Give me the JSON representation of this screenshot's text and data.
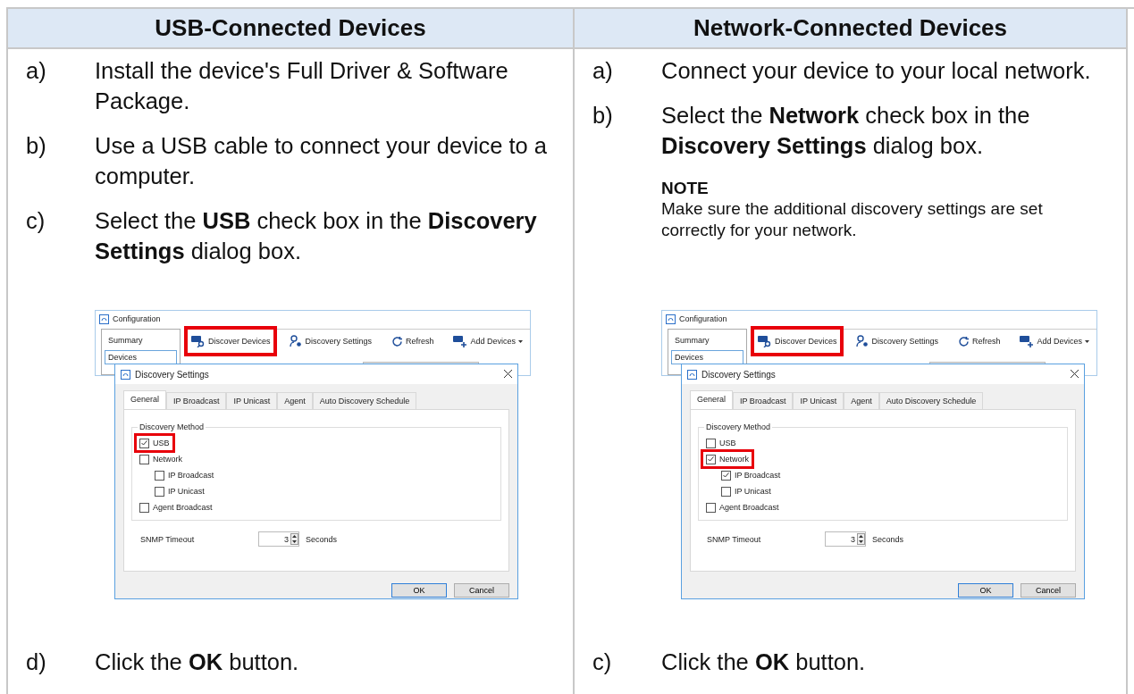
{
  "columns": [
    {
      "heading": "USB-Connected Devices",
      "items": [
        {
          "kind": "step",
          "label": "a)",
          "text": "Install the device's Full Driver & Software Package."
        },
        {
          "kind": "step",
          "label": "b)",
          "text": "Use a USB cable to connect your device to a computer."
        },
        {
          "kind": "step",
          "label": "c)",
          "text": "Select the **USB** check box in the **Discovery Settings** dialog box."
        },
        {
          "kind": "screenshot",
          "window_title": "Configuration",
          "sidebar": [
            {
              "label": "Summary",
              "selected": false
            },
            {
              "label": "Devices",
              "selected": true
            }
          ],
          "toolbar": [
            {
              "label": "Discover Devices",
              "highlighted": true
            },
            {
              "label": "Discovery Settings",
              "highlighted": false
            },
            {
              "label": "Refresh",
              "highlighted": false
            },
            {
              "label": "Add Devices",
              "highlighted": false,
              "dropdown": true
            }
          ],
          "dialog": {
            "title": "Discovery Settings",
            "tabs": [
              {
                "label": "General",
                "selected": true
              },
              {
                "label": "IP Broadcast",
                "selected": false
              },
              {
                "label": "IP Unicast",
                "selected": false
              },
              {
                "label": "Agent",
                "selected": false
              },
              {
                "label": "Auto Discovery Schedule",
                "selected": false
              }
            ],
            "group_label": "Discovery Method",
            "options": [
              {
                "label": "USB",
                "checked": true,
                "highlighted": true
              },
              {
                "label": "Network",
                "checked": false,
                "highlighted": false,
                "children": [
                  {
                    "label": "IP Broadcast",
                    "checked": false,
                    "highlighted": false
                  },
                  {
                    "label": "IP Unicast",
                    "checked": false,
                    "highlighted": false
                  }
                ]
              },
              {
                "label": "Agent Broadcast",
                "checked": false,
                "highlighted": false
              }
            ],
            "timeout_label": "SNMP Timeout",
            "timeout_value": "3",
            "timeout_unit": "Seconds",
            "buttons": [
              {
                "label": "OK",
                "default": true
              },
              {
                "label": "Cancel",
                "default": false
              }
            ]
          }
        },
        {
          "kind": "step",
          "label": "d)",
          "text": "Click the **OK** button."
        }
      ]
    },
    {
      "heading": "Network-Connected Devices",
      "items": [
        {
          "kind": "step",
          "label": "a)",
          "text": "Connect your device to your local network."
        },
        {
          "kind": "step",
          "label": "b)",
          "text": "Select the **Network** check box in the **Discovery Settings** dialog box."
        },
        {
          "kind": "note",
          "title": "NOTE",
          "text": "Make sure the additional discovery settings are set correctly for your network."
        },
        {
          "kind": "screenshot",
          "window_title": "Configuration",
          "sidebar": [
            {
              "label": "Summary",
              "selected": false
            },
            {
              "label": "Devices",
              "selected": true
            }
          ],
          "toolbar": [
            {
              "label": "Discover Devices",
              "highlighted": true
            },
            {
              "label": "Discovery Settings",
              "highlighted": false
            },
            {
              "label": "Refresh",
              "highlighted": false
            },
            {
              "label": "Add Devices",
              "highlighted": false,
              "dropdown": true
            }
          ],
          "dialog": {
            "title": "Discovery Settings",
            "tabs": [
              {
                "label": "General",
                "selected": true
              },
              {
                "label": "IP Broadcast",
                "selected": false
              },
              {
                "label": "IP Unicast",
                "selected": false
              },
              {
                "label": "Agent",
                "selected": false
              },
              {
                "label": "Auto Discovery Schedule",
                "selected": false
              }
            ],
            "group_label": "Discovery Method",
            "options": [
              {
                "label": "USB",
                "checked": false,
                "highlighted": false
              },
              {
                "label": "Network",
                "checked": true,
                "highlighted": true,
                "children": [
                  {
                    "label": "IP Broadcast",
                    "checked": true,
                    "highlighted": false
                  },
                  {
                    "label": "IP Unicast",
                    "checked": false,
                    "highlighted": false
                  }
                ]
              },
              {
                "label": "Agent Broadcast",
                "checked": false,
                "highlighted": false
              }
            ],
            "timeout_label": "SNMP Timeout",
            "timeout_value": "3",
            "timeout_unit": "Seconds",
            "buttons": [
              {
                "label": "OK",
                "default": true
              },
              {
                "label": "Cancel",
                "default": false
              }
            ]
          }
        },
        {
          "kind": "step",
          "label": "c)",
          "text": "Click the **OK** button."
        }
      ]
    }
  ]
}
